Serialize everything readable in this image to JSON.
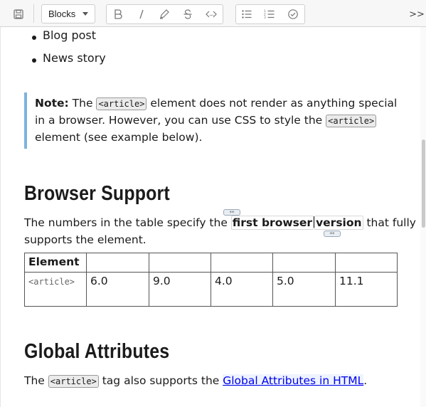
{
  "toolbar": {
    "blocks_label": "Blocks",
    "overflow_label": ">>"
  },
  "list_items": [
    "Blog post",
    "News story"
  ],
  "note": {
    "label": "Note:",
    "line1_a": " The ",
    "code1": "<article>",
    "line1_b": " element does not render as anything special",
    "line2_a": "in a browser. However, you can use CSS to style the ",
    "code2": "<article>",
    "line3": "element (see example below)."
  },
  "browser_support": {
    "heading": "Browser Support",
    "para_a": "The numbers in the table specify the ",
    "strong1": "first browser",
    "strong2": "version",
    "para_b": " that fully",
    "para_line2": "supports the element.",
    "hint_marker": "**",
    "table": {
      "header": [
        "Element",
        "",
        "",
        "",
        "",
        ""
      ],
      "row": [
        "<article>",
        "6.0",
        "9.0",
        "4.0",
        "5.0",
        "11.1"
      ]
    }
  },
  "global_attributes": {
    "heading": "Global Attributes",
    "para_a": "The ",
    "code": "<article>",
    "para_b": " tag also supports the ",
    "link": "Global Attributes in HTML",
    "para_c": "."
  }
}
